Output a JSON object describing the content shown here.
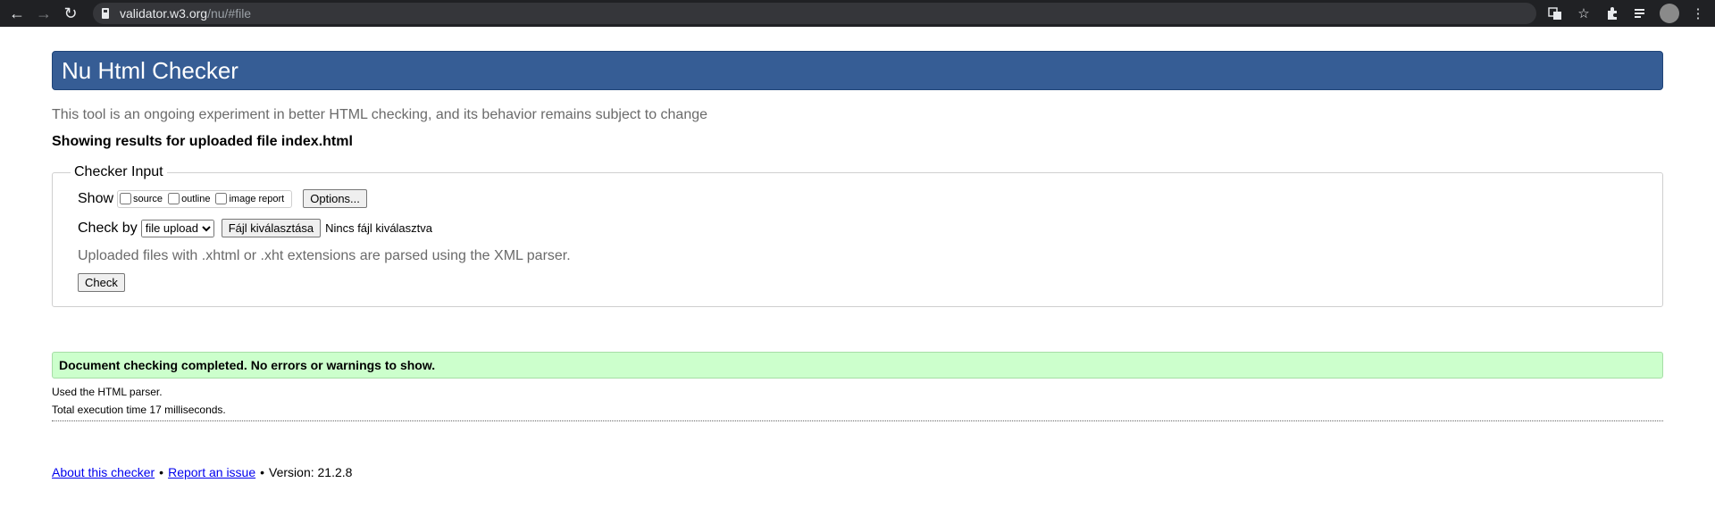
{
  "browser": {
    "url_host": "validator.w3.org",
    "url_path": "/nu/#file",
    "icons": [
      "back-arrow",
      "forward-arrow",
      "reload",
      "lock",
      "translate",
      "star",
      "puzzle",
      "reading-list",
      "avatar",
      "more"
    ]
  },
  "header": {
    "title": "Nu Html Checker"
  },
  "intro": "This tool is an ongoing experiment in better HTML checking, and its behavior remains subject to change",
  "showing": "Showing results for uploaded file index.html",
  "checker": {
    "legend": "Checker Input",
    "show_label": "Show",
    "options": {
      "source": "source",
      "outline": "outline",
      "image_report": "image report"
    },
    "options_button": "Options...",
    "check_by_label": "Check by",
    "check_by_selected": "file upload",
    "file_button": "Fájl kiválasztása",
    "file_status": "Nincs fájl kiválasztva",
    "note": "Uploaded files with .xhtml or .xht extensions are parsed using the XML parser.",
    "check_button": "Check"
  },
  "result": {
    "message": "Document checking completed. No errors or warnings to show.",
    "parser": "Used the HTML parser.",
    "time": "Total execution time 17 milliseconds."
  },
  "footer": {
    "about": "About this checker",
    "separator": "•",
    "report": "Report an issue",
    "version": "Version: 21.2.8"
  },
  "colors": {
    "banner": "#365d95",
    "success": "#ccffcc",
    "chrome": "#202124"
  }
}
